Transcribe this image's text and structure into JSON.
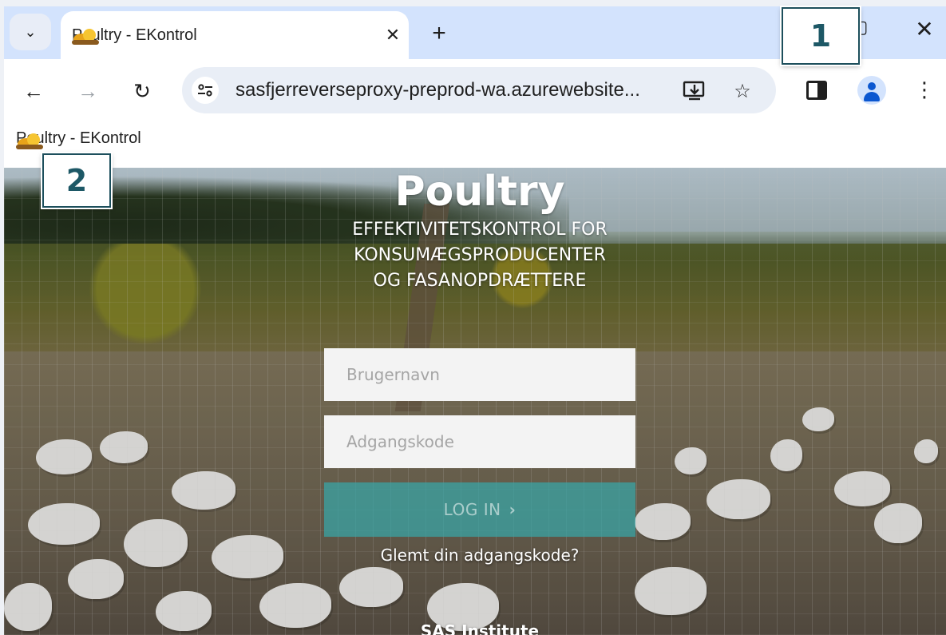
{
  "browser": {
    "tab": {
      "title": "Poultry - EKontrol",
      "close_glyph": "✕"
    },
    "new_tab_glyph": "+",
    "tab_search_glyph": "⌄",
    "window": {
      "minimize_glyph": "–",
      "maximize_glyph": "▢",
      "close_glyph": "✕"
    },
    "toolbar": {
      "back_glyph": "←",
      "forward_glyph": "→",
      "reload_glyph": "↻",
      "url": "sasfjerreverseproxy-preprod-wa.azurewebsite...",
      "install_glyph": "⇩",
      "bookmark_glyph": "☆",
      "menu_glyph": "⋮"
    },
    "bookmarks": [
      {
        "label": "Poultry - EKontrol"
      }
    ]
  },
  "page": {
    "title": "Poultry",
    "subtitle_lines": [
      "EFFEKTIVITETSKONTROL FOR",
      "KONSUMÆGSPRODUCENTER",
      "OG FASANOPDRÆTTERE"
    ],
    "username_placeholder": "Brugernavn",
    "password_placeholder": "Adgangskode",
    "login_label": "LOG IN",
    "login_chevron": "›",
    "forgot_password": "Glemt din adgangskode?",
    "footer_org": "SAS Institute"
  },
  "callouts": [
    {
      "label": "1"
    },
    {
      "label": "2"
    }
  ],
  "colors": {
    "tab_strip": "#d3e3fd",
    "login_button": "#38a6a8",
    "callout_text": "#1d5866"
  },
  "icons": {
    "favicon": "chick-favicon",
    "site_info": "tune-icon",
    "install": "install-app-icon",
    "bookmark": "star-icon",
    "side_panel": "side-panel-icon",
    "profile": "person-icon",
    "menu": "more-vert-icon"
  }
}
